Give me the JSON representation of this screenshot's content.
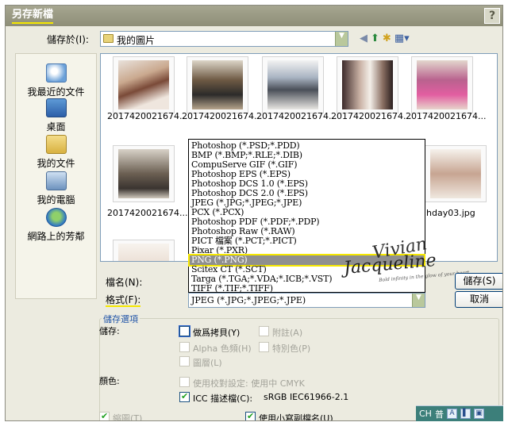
{
  "dialog": {
    "title": "另存新檔",
    "help": "?"
  },
  "save_in": {
    "label": "儲存於(I):",
    "value": "我的圖片"
  },
  "places": [
    {
      "label": "我最近的文件",
      "icon": "recent-documents-icon"
    },
    {
      "label": "桌面",
      "icon": "desktop-icon"
    },
    {
      "label": "我的文件",
      "icon": "my-documents-icon"
    },
    {
      "label": "我的電腦",
      "icon": "my-computer-icon"
    },
    {
      "label": "網路上的芳鄰",
      "icon": "network-places-icon"
    }
  ],
  "files": [
    {
      "name": "2017420021674..."
    },
    {
      "name": "2017420021674..."
    },
    {
      "name": "2017420021674..."
    },
    {
      "name": "2017420021674..."
    },
    {
      "name": "2017420021674..."
    },
    {
      "name": "2017420021674..."
    },
    {
      "name": "hday03.jpg"
    }
  ],
  "format_options": [
    "Photoshop (*.PSD;*.PDD)",
    "BMP (*.BMP;*.RLE;*.DIB)",
    "CompuServe GIF (*.GIF)",
    "Photoshop EPS (*.EPS)",
    "Photoshop DCS 1.0 (*.EPS)",
    "Photoshop DCS 2.0 (*.EPS)",
    "JPEG (*.JPG;*.JPEG;*.JPE)",
    "PCX (*.PCX)",
    "Photoshop PDF (*.PDF;*.PDP)",
    "Photoshop Raw (*.RAW)",
    "PICT 檔案 (*.PCT;*.PICT)",
    "Pixar (*.PXR)",
    "PNG (*.PNG)",
    "Scitex CT (*.SCT)",
    "Targa (*.TGA;*.VDA;*.ICB;*.VST)",
    "TIFF (*.TIF;*.TIFF)"
  ],
  "format_selected_index": 12,
  "watermark": {
    "name1": "Vivian",
    "name2": "Jacqueline",
    "tagline": "Bold infinity in the glow of your heart"
  },
  "filename": {
    "label": "檔名(N):",
    "value": ""
  },
  "format": {
    "label": "格式(F):",
    "value": "JPEG (*.JPG;*.JPEG;*.JPE)"
  },
  "buttons": {
    "save": "儲存(S)",
    "cancel": "取消"
  },
  "options": {
    "group_title": "儲存選項",
    "save_label": "儲存:",
    "as_copy": "做爲拷貝(Y)",
    "annotations": "附註(A)",
    "alpha": "Alpha 色頻(H)",
    "spot": "特別色(P)",
    "layers": "圖層(L)",
    "color_label": "顏色:",
    "use_proof": "使用校對設定: 使用中 CMYK",
    "icc": "ICC 描述檔(C):",
    "icc_value": "sRGB IEC61966-2.1",
    "thumbnail": "縮圖(T)",
    "lowercase_ext": "使用小寫副檔名(U)"
  },
  "taskbar": {
    "lang": "CH",
    "ime": "普"
  }
}
